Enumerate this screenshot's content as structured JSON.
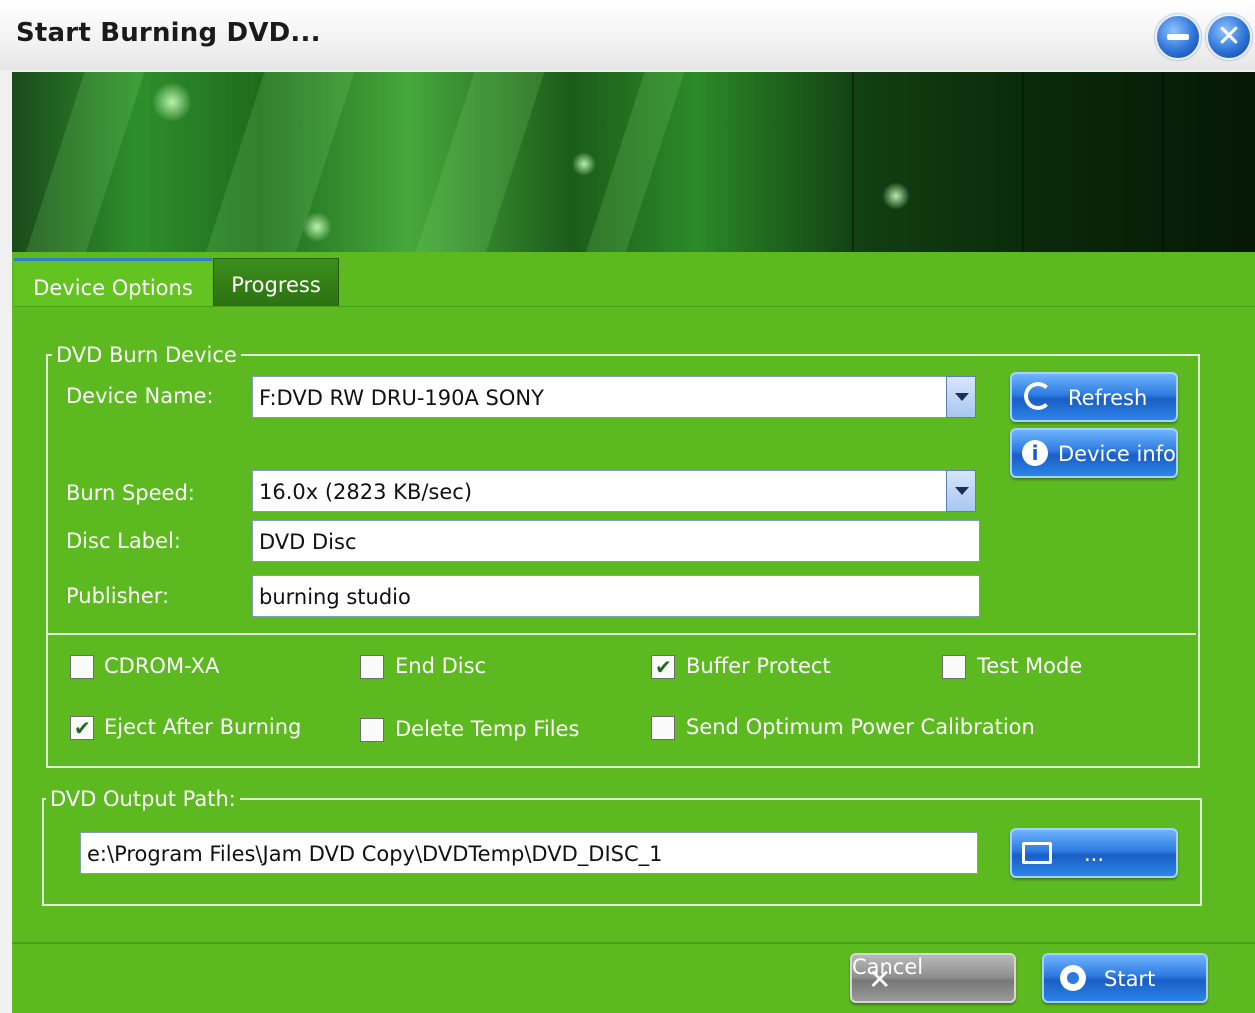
{
  "window": {
    "title": "Start Burning DVD..."
  },
  "tabs": [
    {
      "label": "Device Options"
    },
    {
      "label": "Progress"
    }
  ],
  "device_group": {
    "legend": "DVD Burn Device",
    "device_name_label": "Device Name:",
    "device_name_value": "F:DVD RW DRU-190A SONY",
    "burn_speed_label": "Burn Speed:",
    "burn_speed_value": "16.0x (2823 KB/sec)",
    "disc_label_label": "Disc Label:",
    "disc_label_value": "DVD Disc",
    "publisher_label": "Publisher:",
    "publisher_value": "burning studio",
    "refresh_label": "Refresh",
    "device_info_label": "Device info"
  },
  "options": [
    {
      "label": "CDROM-XA",
      "checked": false
    },
    {
      "label": "End Disc",
      "checked": false
    },
    {
      "label": "Buffer Protect",
      "checked": true
    },
    {
      "label": "Test Mode",
      "checked": false
    },
    {
      "label": "Eject After Burning",
      "checked": true
    },
    {
      "label": "Delete Temp Files",
      "checked": false
    },
    {
      "label": "Send Optimum Power Calibration",
      "checked": false
    }
  ],
  "output_group": {
    "legend": "DVD Output Path:",
    "path_value": "e:\\Program Files\\Jam DVD Copy\\DVDTemp\\DVD_DISC_1",
    "browse_label": "..."
  },
  "footer": {
    "cancel_label": "Cancel",
    "start_label": "Start"
  },
  "colors": {
    "accent_green": "#5cb91f",
    "button_blue": "#2e7be0"
  }
}
